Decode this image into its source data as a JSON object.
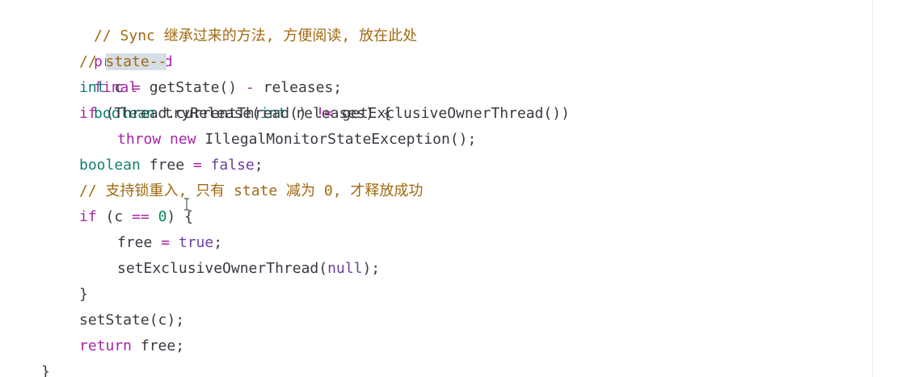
{
  "code": {
    "line1": {
      "comment": "// Sync 继承过来的方法, 方便阅读, 放在此处"
    },
    "line2": {
      "kw1": "protected",
      "kw2": "final",
      "type": "boolean",
      "name": " tryRelease(",
      "param_type": "int",
      "rest": " releases) {"
    },
    "line3": {
      "comment_prefix": "// ",
      "highlighted": "state--"
    },
    "line4": {
      "type": "int",
      "rest1": " c ",
      "op1": "=",
      "rest2": " getState() ",
      "op2": "-",
      "rest3": " releases;"
    },
    "line5": {
      "kw": "if",
      "rest1": " (Thread.currentThread() ",
      "op": "!=",
      "rest2": " getExclusiveOwnerThread())"
    },
    "line6": {
      "kw1": "throw",
      "kw2": "new",
      "rest": " IllegalMonitorStateException();"
    },
    "line7": {
      "type": "boolean",
      "rest1": " free ",
      "op": "=",
      "literal": "false",
      "rest2": ";"
    },
    "line8": {
      "comment": "// 支持锁重入, 只有 state 减为 0, 才释放成功"
    },
    "line9": {
      "kw": "if",
      "rest1": " (c ",
      "op": "==",
      "number": "0",
      "rest2": ") {"
    },
    "line10": {
      "rest1": "free ",
      "op": "=",
      "literal": "true",
      "rest2": ";"
    },
    "line11": {
      "rest1": "setExclusiveOwnerThread(",
      "literal": "null",
      "rest2": ");"
    },
    "line12": {
      "text": "}"
    },
    "line13": {
      "text": "setState(c);"
    },
    "line14": {
      "kw": "return",
      "rest": " free;"
    },
    "line15": {
      "text": "}"
    }
  },
  "colors": {
    "comment": "#a0690f",
    "keyword": "#a626a4",
    "type": "#0f7f72",
    "literal": "#6b3fa0",
    "text": "#383a42",
    "highlight": "#d7dde4"
  },
  "cursor": {
    "icon": "text-ibeam-cursor-icon"
  }
}
